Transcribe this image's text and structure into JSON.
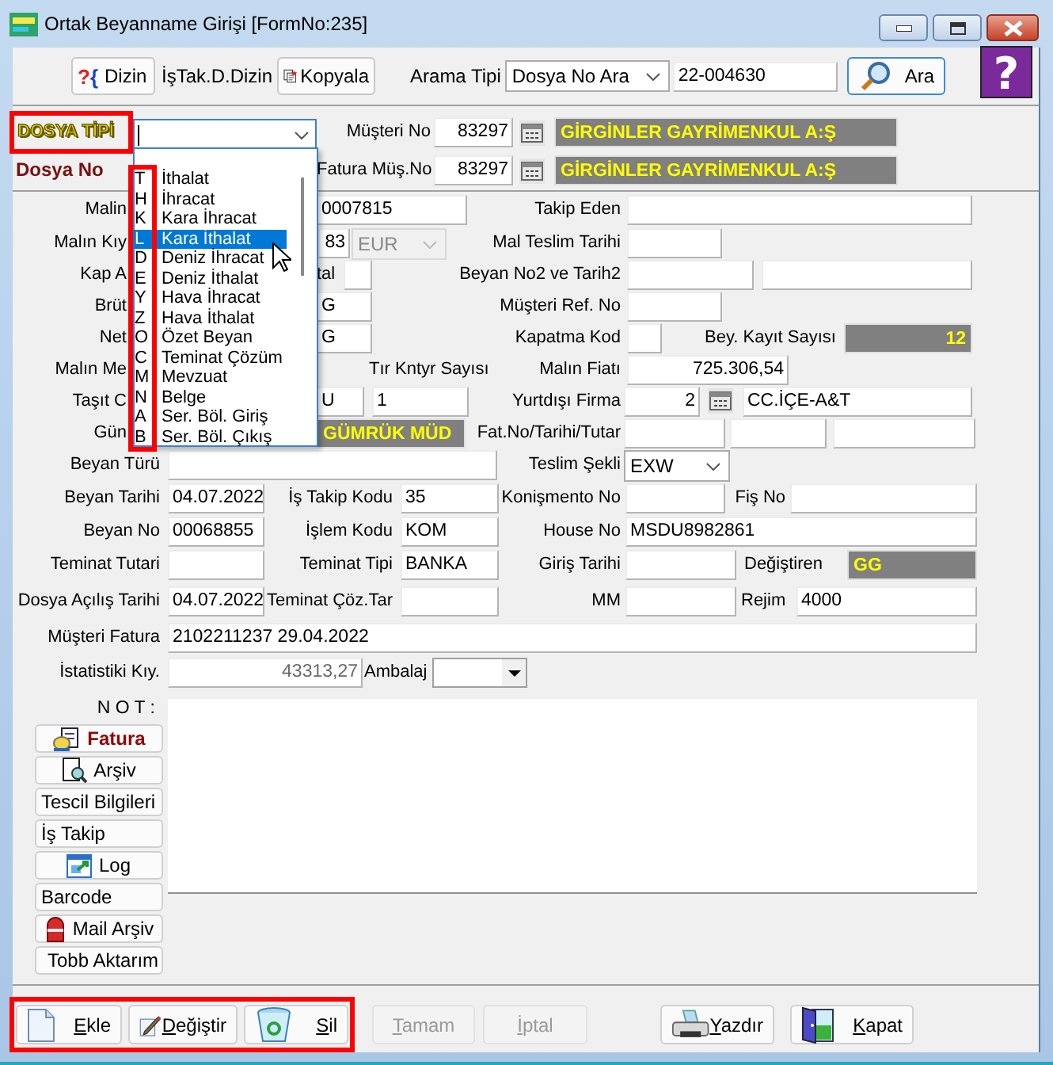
{
  "window": {
    "title": "Ortak Beyanname Girişi [FormNo:235]"
  },
  "toolbar": {
    "items": [
      {
        "kind": "index",
        "glyph": "?{",
        "label": "Dizin"
      },
      {
        "kind": "text",
        "label": "İşTak.D.Dizin"
      },
      {
        "kind": "copy",
        "label": "Kopyala"
      }
    ],
    "search_label": "Arama Tipi",
    "search_type": "Dosya No Ara",
    "search_value": "22-004630",
    "search_button": "Ara",
    "help": "?"
  },
  "header": {
    "dosya_tipi": {
      "label": "DOSYA TİPİ",
      "highlighted": true
    },
    "dosya_no_label": "Dosya No",
    "customers": [
      {
        "label": "Müşteri No",
        "number": "83297",
        "name": "GİRGİNLER GAYRİMENKUL A:Ş"
      },
      {
        "label": "Fatura Müş.No",
        "number": "83297",
        "name": "GİRGİNLER GAYRİMENKUL A:Ş"
      }
    ]
  },
  "dosya_tipi_list": {
    "codes_highlighted": true,
    "items": [
      {
        "code": "T",
        "name": "İthalat",
        "selected": false
      },
      {
        "code": "H",
        "name": "İhracat",
        "selected": false
      },
      {
        "code": "K",
        "name": "Kara İhracat",
        "selected": false
      },
      {
        "code": "L",
        "name": "Kara İthalat",
        "selected": true
      },
      {
        "code": "D",
        "name": "Deniz İhracat",
        "selected": false
      },
      {
        "code": "E",
        "name": "Deniz İthalat",
        "selected": false
      },
      {
        "code": "Y",
        "name": "Hava İhracat",
        "selected": false
      },
      {
        "code": "Z",
        "name": "Hava İthalat",
        "selected": false
      },
      {
        "code": "O",
        "name": "Özet Beyan",
        "selected": false
      },
      {
        "code": "C",
        "name": "Teminat Çözüm",
        "selected": false
      },
      {
        "code": "M",
        "name": "Mevzuat",
        "selected": false
      },
      {
        "code": "N",
        "name": "Belge",
        "selected": false
      },
      {
        "code": "A",
        "name": "Ser. Böl. Giriş",
        "selected": false
      },
      {
        "code": "B",
        "name": "Ser. Böl. Çıkış",
        "selected": false
      }
    ]
  },
  "form_rows": [
    {
      "items": [
        {
          "kind": "label",
          "text": "Malin"
        },
        {
          "kind": "field",
          "value": "0007815"
        },
        {
          "kind": "label",
          "text": "Takip Eden"
        },
        {
          "kind": "field"
        }
      ]
    },
    {
      "items": [
        {
          "kind": "label",
          "text": "Malın Kıy"
        },
        {
          "kind": "field",
          "value": "83"
        },
        {
          "kind": "combo",
          "value": "EUR",
          "disabled": true
        },
        {
          "kind": "label",
          "text": "Mal Teslim Tarihi"
        },
        {
          "kind": "field"
        }
      ]
    },
    {
      "items": [
        {
          "kind": "label",
          "text": "Kap A"
        },
        {
          "kind": "label",
          "text": "tal"
        },
        {
          "kind": "field"
        },
        {
          "kind": "label",
          "text": "Beyan No2 ve Tarih2"
        },
        {
          "kind": "field"
        },
        {
          "kind": "field"
        }
      ]
    },
    {
      "items": [
        {
          "kind": "label",
          "text": "Brüt"
        },
        {
          "kind": "field",
          "value": "G"
        },
        {
          "kind": "label",
          "text": "Müşteri Ref. No"
        },
        {
          "kind": "field"
        }
      ]
    },
    {
      "items": [
        {
          "kind": "label",
          "text": "Net"
        },
        {
          "kind": "field",
          "value": "G"
        },
        {
          "kind": "label",
          "text": "Kapatma Kod"
        },
        {
          "kind": "field"
        },
        {
          "kind": "label",
          "text": "Bey. Kayıt Sayısı"
        },
        {
          "kind": "banner",
          "value": "12"
        }
      ]
    },
    {
      "items": [
        {
          "kind": "label",
          "text": "Malın Me"
        },
        {
          "kind": "label",
          "text": "Tır Kntyr Sayısı"
        },
        {
          "kind": "label",
          "text": "Malın Fiatı"
        },
        {
          "kind": "field",
          "value": "725.306,54"
        }
      ]
    },
    {
      "items": [
        {
          "kind": "label",
          "text": "Taşıt C"
        },
        {
          "kind": "field",
          "value": "U"
        },
        {
          "kind": "field",
          "value": "1"
        },
        {
          "kind": "label",
          "text": "Yurtdışı Firma"
        },
        {
          "kind": "field",
          "value": "2"
        },
        {
          "kind": "lookup"
        },
        {
          "kind": "field",
          "value": "CC.İÇE-A&T"
        }
      ]
    },
    {
      "items": [
        {
          "kind": "label",
          "text": "Gün"
        },
        {
          "kind": "banner",
          "value": "GÜMRÜK MÜD"
        },
        {
          "kind": "label",
          "text": "Fat.No/Tarihi/Tutar"
        },
        {
          "kind": "field"
        },
        {
          "kind": "field"
        },
        {
          "kind": "field"
        }
      ]
    },
    {
      "items": [
        {
          "kind": "label",
          "text": "Beyan Türü"
        },
        {
          "kind": "field"
        },
        {
          "kind": "label",
          "text": "Teslim Şekli"
        },
        {
          "kind": "combo",
          "value": "EXW",
          "disabled": false
        }
      ]
    },
    {
      "items": [
        {
          "kind": "label",
          "text": "Beyan Tarihi"
        },
        {
          "kind": "field",
          "value": "04.07.2022"
        },
        {
          "kind": "label",
          "text": "İş Takip Kodu"
        },
        {
          "kind": "field",
          "value": "35"
        },
        {
          "kind": "label",
          "text": "Konişmento No"
        },
        {
          "kind": "field"
        },
        {
          "kind": "label",
          "text": "Fiş No"
        },
        {
          "kind": "field"
        }
      ]
    },
    {
      "items": [
        {
          "kind": "label",
          "text": "Beyan No"
        },
        {
          "kind": "field",
          "value": "00068855"
        },
        {
          "kind": "label",
          "text": "İşlem Kodu"
        },
        {
          "kind": "field",
          "value": "KOM"
        },
        {
          "kind": "label",
          "text": "House No"
        },
        {
          "kind": "field",
          "value": "MSDU8982861"
        }
      ]
    },
    {
      "items": [
        {
          "kind": "label",
          "text": "Teminat Tutari"
        },
        {
          "kind": "field"
        },
        {
          "kind": "label",
          "text": "Teminat Tipi"
        },
        {
          "kind": "field",
          "value": "BANKA"
        },
        {
          "kind": "label",
          "text": "Giriş Tarihi"
        },
        {
          "kind": "field"
        },
        {
          "kind": "label",
          "text": "Değiştiren"
        },
        {
          "kind": "banner",
          "value": "GG"
        }
      ]
    },
    {
      "items": [
        {
          "kind": "label",
          "text": "Dosya Açılış Tarihi"
        },
        {
          "kind": "field",
          "value": "04.07.2022"
        },
        {
          "kind": "label",
          "text": "Teminat Çöz.Tar"
        },
        {
          "kind": "field"
        },
        {
          "kind": "label",
          "text": "MM"
        },
        {
          "kind": "field"
        },
        {
          "kind": "label",
          "text": "Rejim"
        },
        {
          "kind": "field",
          "value": "4000"
        }
      ]
    },
    {
      "items": [
        {
          "kind": "label",
          "text": "Müşteri Fatura"
        },
        {
          "kind": "field",
          "value": "2102211237 29.04.2022"
        }
      ]
    },
    {
      "items": [
        {
          "kind": "label",
          "text": "İstatistiki Kıy."
        },
        {
          "kind": "field",
          "value": "43313,27"
        },
        {
          "kind": "label",
          "text": "Ambalaj"
        },
        {
          "kind": "picker"
        }
      ]
    }
  ],
  "notes": {
    "label": "N O T :"
  },
  "side_buttons": [
    {
      "kind": "invoice",
      "label": "Fatura"
    },
    {
      "kind": "archive",
      "label": "Arşiv"
    },
    {
      "kind": "plain",
      "label": "Tescil Bilgileri"
    },
    {
      "kind": "plain",
      "label": "İş Takip"
    },
    {
      "kind": "log",
      "label": "Log"
    },
    {
      "kind": "plain",
      "label": "Barcode"
    },
    {
      "kind": "mail",
      "label": "Mail Arşiv"
    },
    {
      "kind": "transfer",
      "label": "Tobb Aktarım"
    }
  ],
  "footer_groups": [
    {
      "highlighted": true,
      "buttons": [
        {
          "kind": "add",
          "label": "Ekle",
          "disabled": false
        },
        {
          "kind": "edit",
          "label": "Değiştir",
          "disabled": false
        },
        {
          "kind": "delete",
          "label": "Sil",
          "disabled": false
        }
      ]
    },
    {
      "highlighted": false,
      "buttons": [
        {
          "kind": "confirm",
          "label": "Tamam",
          "disabled": true
        },
        {
          "kind": "cancel",
          "label": "İptal",
          "disabled": true
        },
        {
          "kind": "print",
          "label": "Yazdır",
          "disabled": false
        },
        {
          "kind": "close",
          "label": "Kapat",
          "disabled": false
        }
      ]
    }
  ]
}
